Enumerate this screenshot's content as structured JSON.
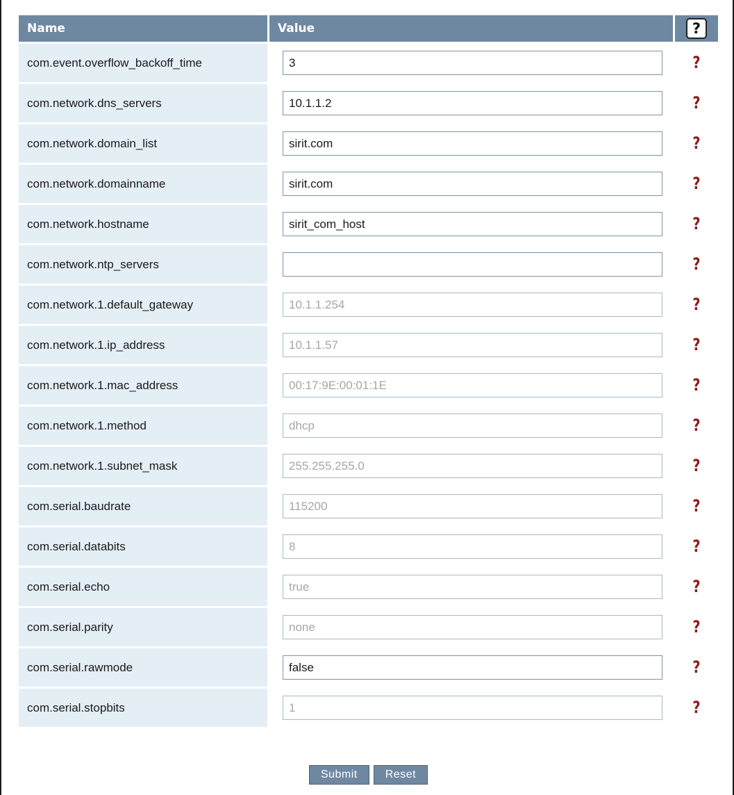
{
  "table": {
    "header_name": "Name",
    "header_value": "Value",
    "header_help": "?",
    "rows": [
      {
        "name": "com.event.overflow_backoff_time",
        "value": "3",
        "editable": true
      },
      {
        "name": "com.network.dns_servers",
        "value": "10.1.1.2",
        "editable": true
      },
      {
        "name": "com.network.domain_list",
        "value": "sirit.com",
        "editable": true
      },
      {
        "name": "com.network.domainname",
        "value": "sirit.com",
        "editable": true
      },
      {
        "name": "com.network.hostname",
        "value": "sirit_com_host",
        "editable": true
      },
      {
        "name": "com.network.ntp_servers",
        "value": "",
        "editable": true
      },
      {
        "name": "com.network.1.default_gateway",
        "value": "10.1.1.254",
        "editable": false
      },
      {
        "name": "com.network.1.ip_address",
        "value": "10.1.1.57",
        "editable": false
      },
      {
        "name": "com.network.1.mac_address",
        "value": "00:17:9E:00:01:1E",
        "editable": false
      },
      {
        "name": "com.network.1.method",
        "value": "dhcp",
        "editable": false
      },
      {
        "name": "com.network.1.subnet_mask",
        "value": "255.255.255.0",
        "editable": false
      },
      {
        "name": "com.serial.baudrate",
        "value": "115200",
        "editable": false
      },
      {
        "name": "com.serial.databits",
        "value": "8",
        "editable": false
      },
      {
        "name": "com.serial.echo",
        "value": "true",
        "editable": false
      },
      {
        "name": "com.serial.parity",
        "value": "none",
        "editable": false
      },
      {
        "name": "com.serial.rawmode",
        "value": "false",
        "editable": true
      },
      {
        "name": "com.serial.stopbits",
        "value": "1",
        "editable": false
      }
    ],
    "row_help": "?"
  },
  "actions": {
    "submit_label": "Submit",
    "reset_label": "Reset"
  },
  "colors": {
    "header_bg": "#6f88a2",
    "name_cell_bg": "#e4eef5",
    "help_mark": "#8e1b1b",
    "readonly_text": "#a6a6a6"
  }
}
